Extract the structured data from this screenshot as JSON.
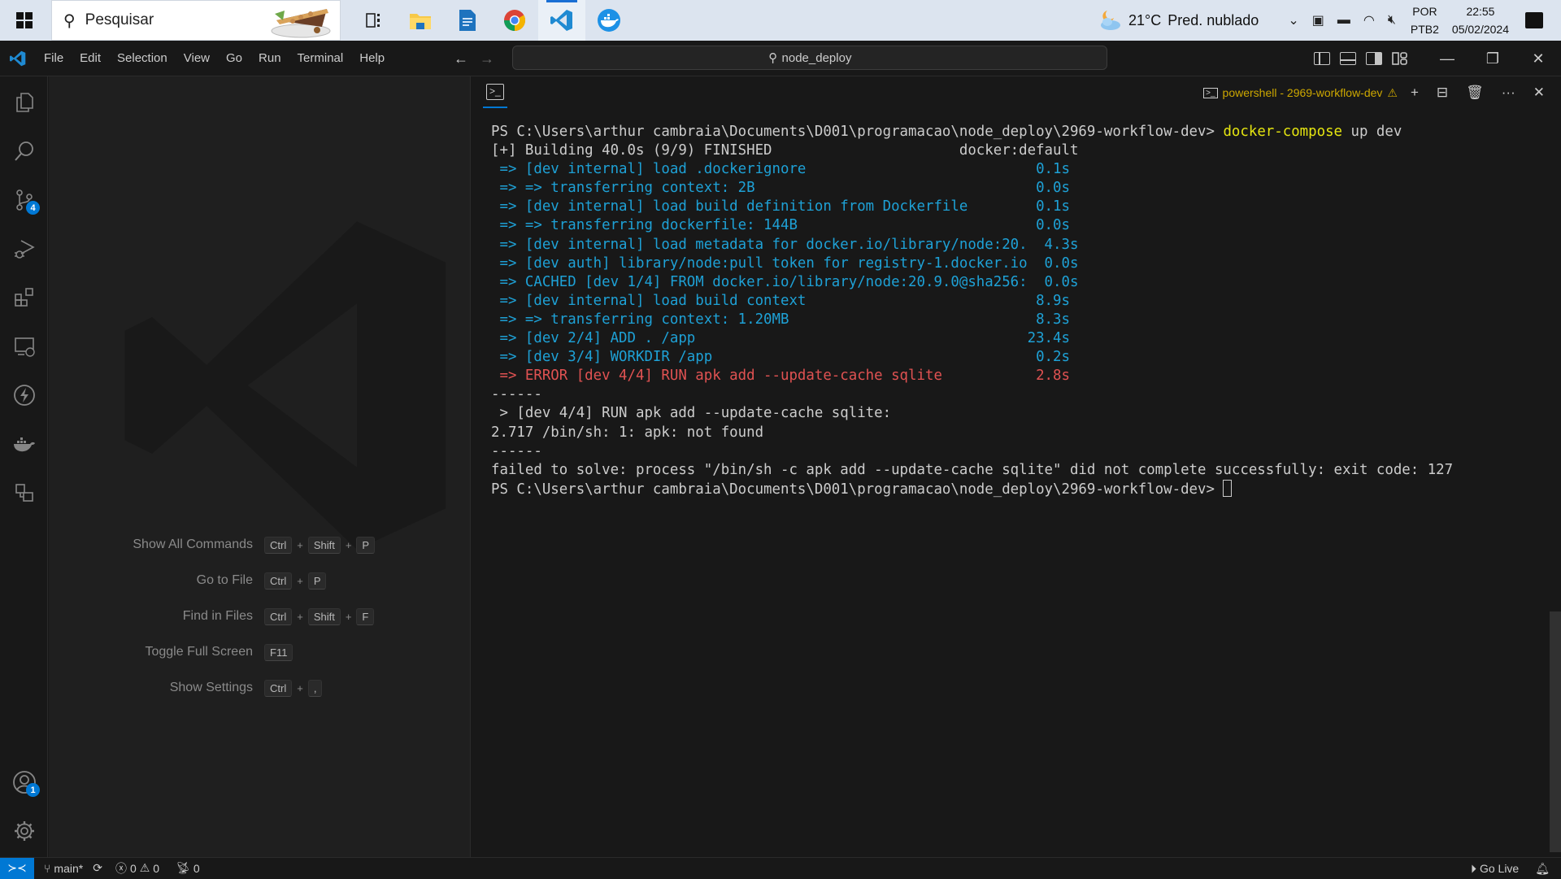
{
  "taskbar": {
    "search_placeholder": "Pesquisar",
    "apps": [
      {
        "name": "task-view",
        "active": false
      },
      {
        "name": "file-explorer",
        "active": false
      },
      {
        "name": "libreoffice-writer",
        "active": false
      },
      {
        "name": "chrome",
        "active": false
      },
      {
        "name": "vscode",
        "active": true
      },
      {
        "name": "docker-desktop",
        "active": false
      }
    ],
    "weather": {
      "temp": "21°C",
      "condition": "Pred. nublado"
    },
    "lang_top": "POR",
    "lang_bottom": "PTB2",
    "time": "22:55",
    "date": "05/02/2024"
  },
  "titlebar": {
    "menu": [
      "File",
      "Edit",
      "Selection",
      "View",
      "Go",
      "Run",
      "Terminal",
      "Help"
    ],
    "command_center": "node_deploy"
  },
  "activity_bar": {
    "items": [
      {
        "name": "explorer",
        "badge": null
      },
      {
        "name": "search",
        "badge": null
      },
      {
        "name": "source-control",
        "badge": "4"
      },
      {
        "name": "run-debug",
        "badge": null
      },
      {
        "name": "extensions",
        "badge": null
      },
      {
        "name": "remote-explorer",
        "badge": null
      },
      {
        "name": "thunder-client",
        "badge": null
      },
      {
        "name": "docker",
        "badge": null
      },
      {
        "name": "remote-containers",
        "badge": null
      }
    ],
    "accounts_badge": "1"
  },
  "editor_watermark": {
    "shortcuts": [
      {
        "label": "Show All Commands",
        "keys": [
          "Ctrl",
          "Shift",
          "P"
        ]
      },
      {
        "label": "Go to File",
        "keys": [
          "Ctrl",
          "P"
        ]
      },
      {
        "label": "Find in Files",
        "keys": [
          "Ctrl",
          "Shift",
          "F"
        ]
      },
      {
        "label": "Toggle Full Screen",
        "keys": [
          "F11"
        ]
      },
      {
        "label": "Show Settings",
        "keys": [
          "Ctrl",
          ","
        ]
      }
    ]
  },
  "terminal": {
    "tab_name": "powershell - 2969-workflow-dev",
    "lines": [
      {
        "segments": [
          {
            "text": "PS C:\\Users\\arthur cambraia\\Documents\\D001\\programacao\\node_deploy\\2969-workflow-dev> ",
            "color": "default"
          },
          {
            "text": "docker-compose",
            "color": "yellow"
          },
          {
            "text": " up dev",
            "color": "default"
          }
        ]
      },
      {
        "segments": [
          {
            "text": "[+] Building 40.0s (9/9) FINISHED                      docker:default",
            "color": "default"
          }
        ]
      },
      {
        "segments": [
          {
            "text": " => [dev internal] load .dockerignore                           0.1s",
            "color": "blue"
          }
        ]
      },
      {
        "segments": [
          {
            "text": " => => transferring context: 2B                                 0.0s",
            "color": "blue"
          }
        ]
      },
      {
        "segments": [
          {
            "text": " => [dev internal] load build definition from Dockerfile        0.1s",
            "color": "blue"
          }
        ]
      },
      {
        "segments": [
          {
            "text": " => => transferring dockerfile: 144B                            0.0s",
            "color": "blue"
          }
        ]
      },
      {
        "segments": [
          {
            "text": " => [dev internal] load metadata for docker.io/library/node:20.  4.3s",
            "color": "blue"
          }
        ]
      },
      {
        "segments": [
          {
            "text": " => [dev auth] library/node:pull token for registry-1.docker.io  0.0s",
            "color": "blue"
          }
        ]
      },
      {
        "segments": [
          {
            "text": " => CACHED [dev 1/4] FROM docker.io/library/node:20.9.0@sha256:  0.0s",
            "color": "blue"
          }
        ]
      },
      {
        "segments": [
          {
            "text": " => [dev internal] load build context                           8.9s",
            "color": "blue"
          }
        ]
      },
      {
        "segments": [
          {
            "text": " => => transferring context: 1.20MB                             8.3s",
            "color": "blue"
          }
        ]
      },
      {
        "segments": [
          {
            "text": " => [dev 2/4] ADD . /app                                       23.4s",
            "color": "blue"
          }
        ]
      },
      {
        "segments": [
          {
            "text": " => [dev 3/4] WORKDIR /app                                      0.2s",
            "color": "blue"
          }
        ]
      },
      {
        "segments": [
          {
            "text": " => ERROR [dev 4/4] RUN apk add --update-cache sqlite           2.8s",
            "color": "red"
          }
        ]
      },
      {
        "segments": [
          {
            "text": "------",
            "color": "default"
          }
        ]
      },
      {
        "segments": [
          {
            "text": " > [dev 4/4] RUN apk add --update-cache sqlite:",
            "color": "default"
          }
        ]
      },
      {
        "segments": [
          {
            "text": "2.717 /bin/sh: 1: apk: not found",
            "color": "default"
          }
        ]
      },
      {
        "segments": [
          {
            "text": "------",
            "color": "default"
          }
        ]
      },
      {
        "segments": [
          {
            "text": "failed to solve: process \"/bin/sh -c apk add --update-cache sqlite\" did not complete successfully: exit code: 127",
            "color": "default"
          }
        ]
      },
      {
        "segments": [
          {
            "text": "PS C:\\Users\\arthur cambraia\\Documents\\D001\\programacao\\node_deploy\\2969-workflow-dev> ",
            "color": "default"
          }
        ],
        "cursor": true
      }
    ]
  },
  "statusbar": {
    "branch": "main*",
    "errors": "0",
    "warnings": "0",
    "ports": "0",
    "go_live": "Go Live"
  },
  "colors": {
    "accent": "#0078d4",
    "term_blue": "#1ea1d6",
    "term_red": "#e05252",
    "term_yellow": "#e5e510",
    "tab_warning": "#cca700"
  }
}
